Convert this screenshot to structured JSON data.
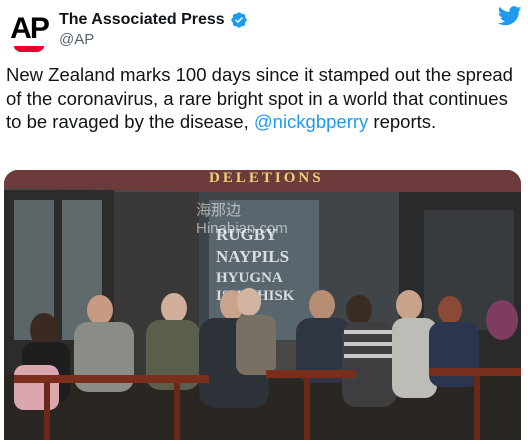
{
  "account": {
    "name": "The Associated Press",
    "handle": "@AP",
    "avatar_text": "AP"
  },
  "icons": {
    "verified": "verified-badge-icon",
    "platform": "twitter-bird-icon"
  },
  "tweet": {
    "text_before": "New Zealand marks 100 days since it stamped out the spread of the coronavirus, a rare bright spot in a world that continues to be ravaged by the disease, ",
    "mention": "@nickgbperry",
    "text_after": " reports."
  },
  "photo": {
    "awning_text": "DELETIONS",
    "watermark_line1": "海那边",
    "watermark_line2": "Hinabian.com",
    "wall_text": [
      "RUGBY",
      "NAYPILS",
      "HYUGNA",
      "ISHWHISK"
    ]
  },
  "colors": {
    "text": "#0f1419",
    "secondary": "#536471",
    "link": "#1d9bf0",
    "verified": "#1d9bf0",
    "ap_red": "#e4002b",
    "awning": "#6e3b3c"
  }
}
